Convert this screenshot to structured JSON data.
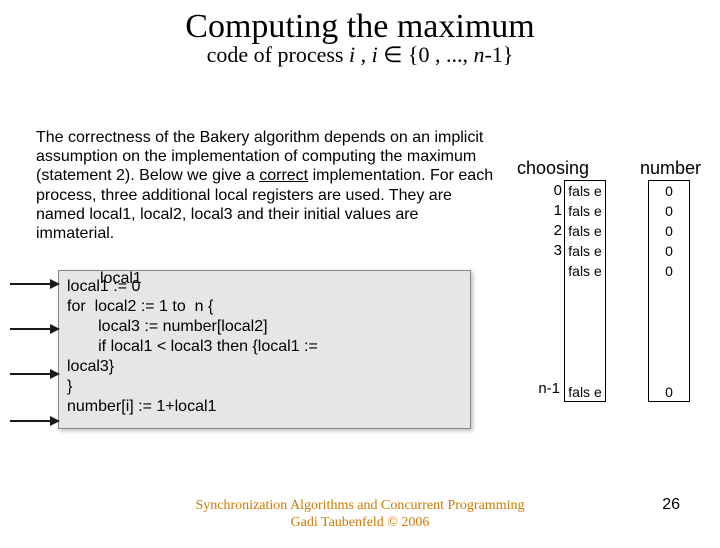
{
  "title": "Computing the maximum",
  "subtitle_a": "code of process ",
  "subtitle_i": "i",
  "subtitle_b": " ,   ",
  "subtitle_c": " ∈ {0 , ..., ",
  "subtitle_n": "n",
  "subtitle_d": "-1}",
  "paragraph_a": "The correctness of the Bakery algorithm depends on an implicit assumption on the implementation of computing the maximum (statement 2). Below we give a ",
  "paragraph_u": "correct",
  "paragraph_b": " implementation. For each process, three additional local registers are used. They are named local1, local2, local3 and their initial values are immaterial.",
  "overlap": "local1",
  "code": "local1 := 0\nfor  local2 := 1 to  n {\n       local3 := number[local2]\n       if local1 < local3 then {local1 :=\nlocal3}\n}\nnumber[i] := 1+local1",
  "hdr_choosing": "choosing",
  "hdr_number": "number",
  "indices": [
    "0",
    "1",
    "2",
    "3"
  ],
  "bottom_index": "n-1",
  "choosing_vals": [
    "fals e",
    "fals e",
    "fals e",
    "fals e",
    "fals e"
  ],
  "choosing_bottom": "fals e",
  "number_vals": [
    "0",
    "0",
    "0",
    "0",
    "0"
  ],
  "number_bottom": "0",
  "footer1": "Synchronization Algorithms and Concurrent Programming",
  "footer2": "Gadi Taubenfeld © 2006",
  "page": "26"
}
